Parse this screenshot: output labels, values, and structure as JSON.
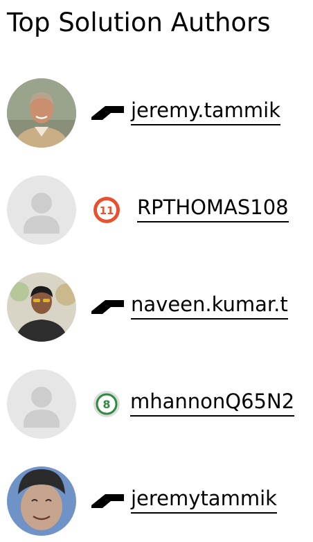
{
  "title": "Top Solution Authors",
  "authors": [
    {
      "name": "jeremy.tammik",
      "avatar": "photo-man-smiling",
      "badge": "autodesk-logo-icon"
    },
    {
      "name": "RPTHOMAS108",
      "avatar": "default-user-icon",
      "badge": "rank-11-badge-icon",
      "badge_text": "11",
      "badge_color": "#e8502f"
    },
    {
      "name": "naveen.kumar.t",
      "avatar": "photo-man-sunglasses",
      "badge": "autodesk-logo-icon"
    },
    {
      "name": "mhannonQ65N2",
      "avatar": "default-user-icon",
      "badge": "rank-8-badge-icon",
      "badge_text": "8",
      "badge_color": "#2e8b3e"
    },
    {
      "name": "jeremytammik",
      "avatar": "photo-man-beanie",
      "badge": "autodesk-logo-icon"
    }
  ]
}
